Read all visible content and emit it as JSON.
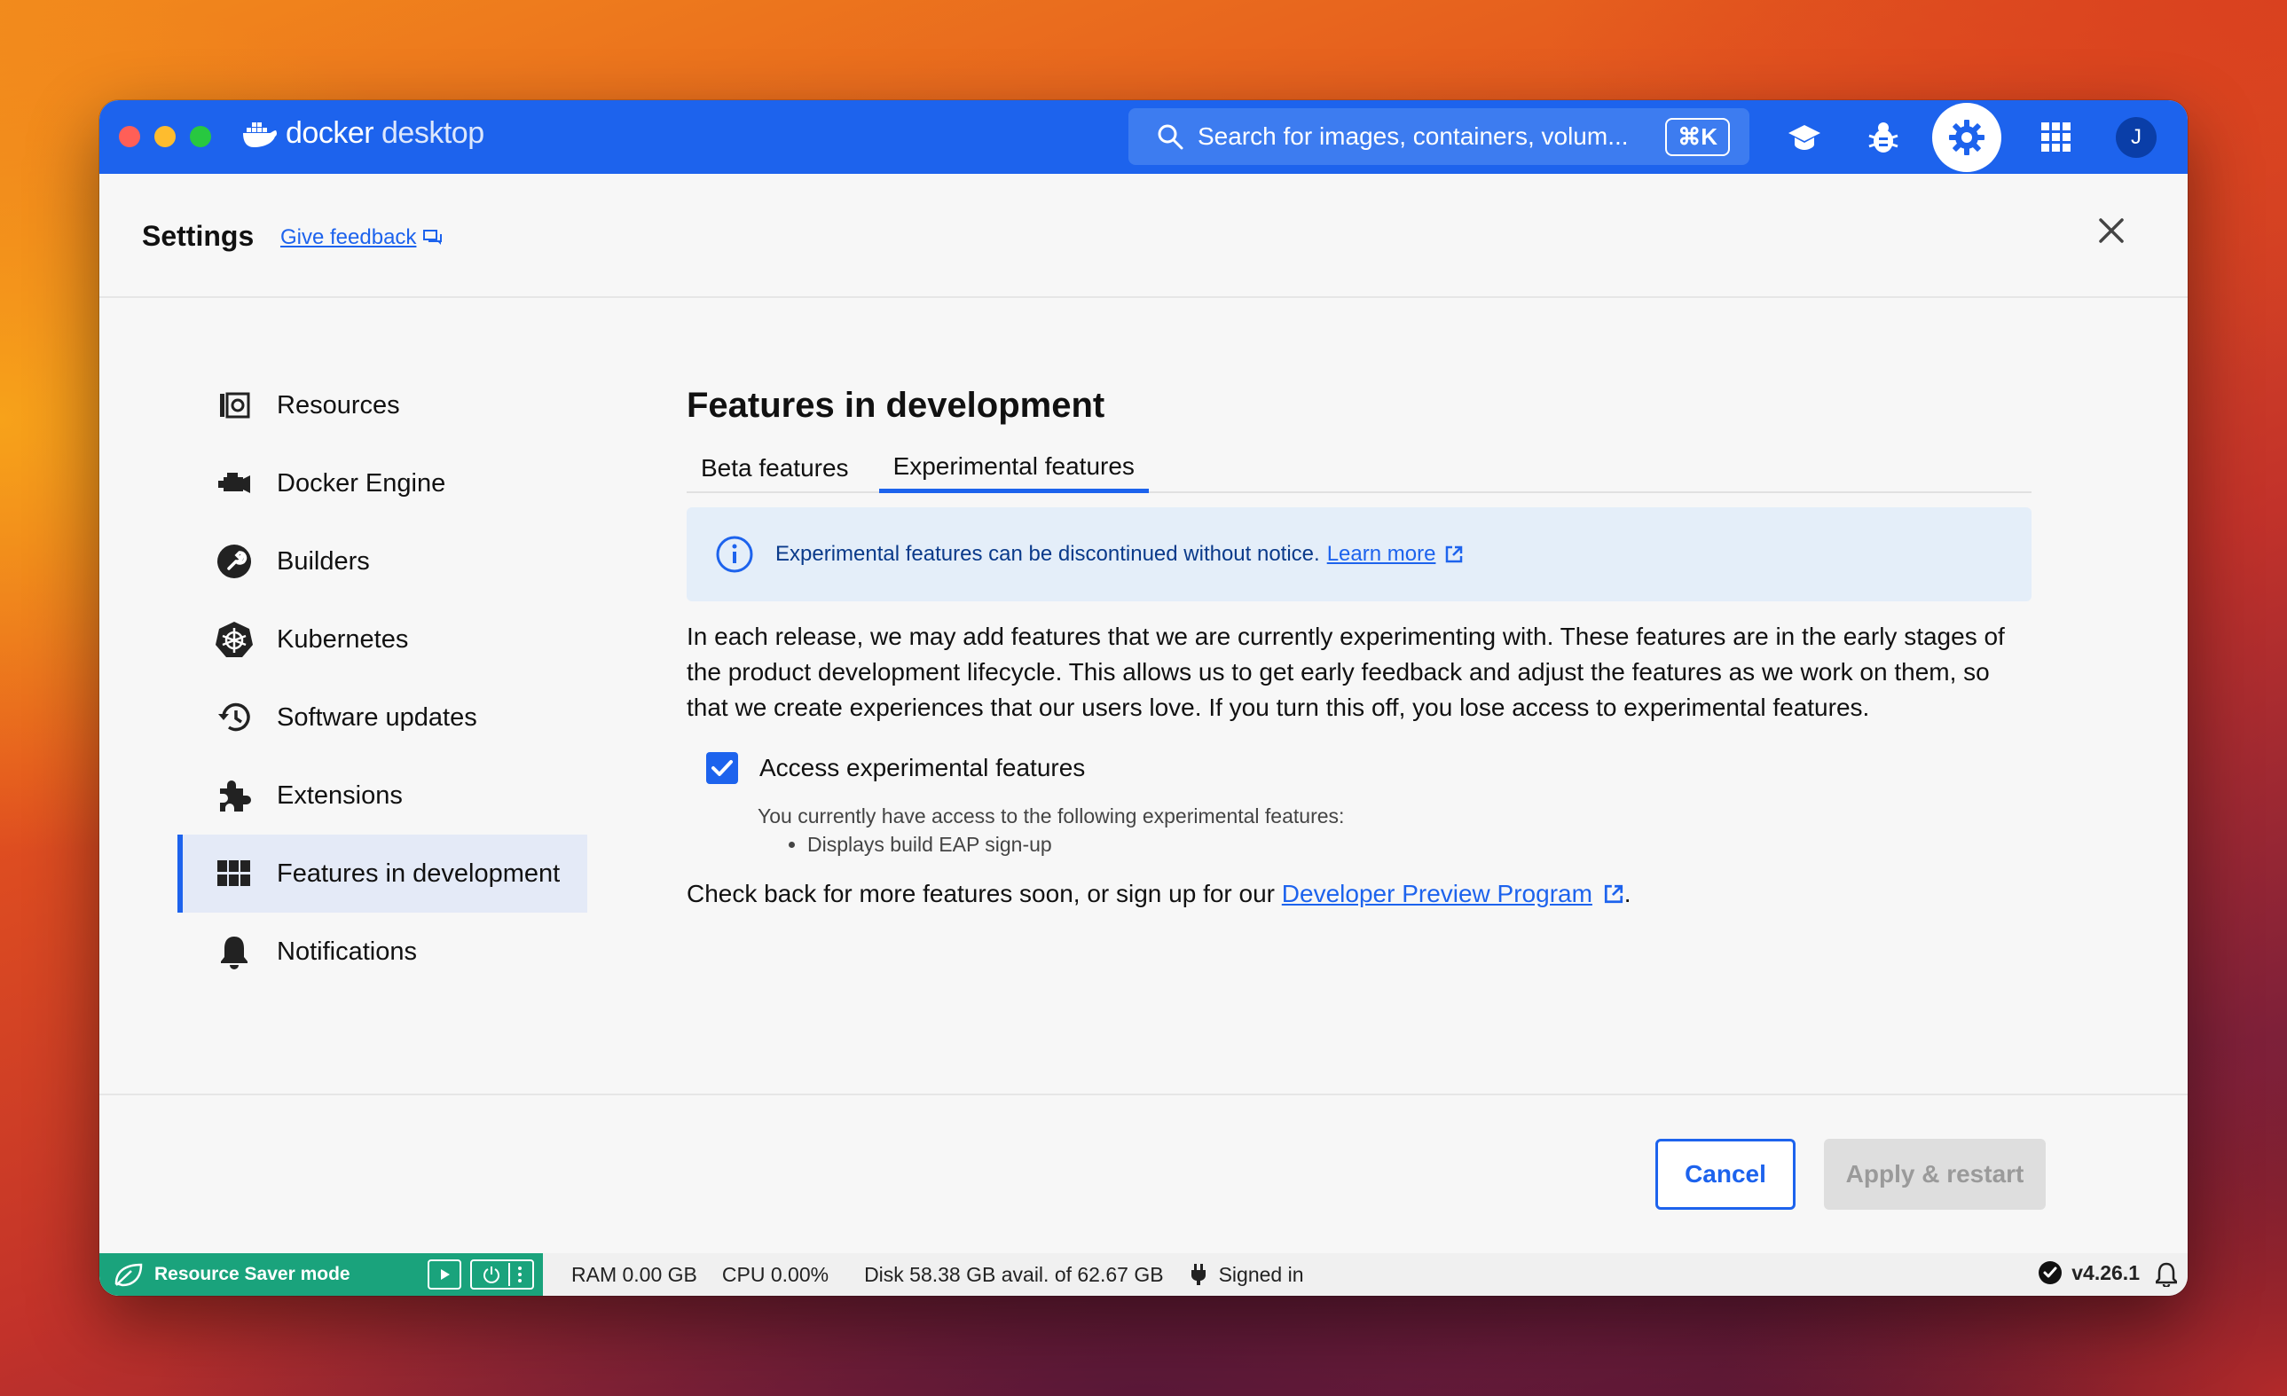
{
  "app": {
    "brand_main": "docker",
    "brand_sub": "desktop",
    "search_placeholder": "Search for images, containers, volum...",
    "search_shortcut": "⌘K",
    "avatar_initial": "J"
  },
  "header": {
    "title": "Settings",
    "feedback": "Give feedback"
  },
  "sidebar": {
    "items": [
      {
        "label": "Resources",
        "icon": "resources-icon"
      },
      {
        "label": "Docker Engine",
        "icon": "engine-icon"
      },
      {
        "label": "Builders",
        "icon": "wrench-icon"
      },
      {
        "label": "Kubernetes",
        "icon": "helm-icon"
      },
      {
        "label": "Software updates",
        "icon": "history-icon"
      },
      {
        "label": "Extensions",
        "icon": "puzzle-icon"
      },
      {
        "label": "Features in development",
        "icon": "grid-icon",
        "active": true
      },
      {
        "label": "Notifications",
        "icon": "bell-icon"
      }
    ]
  },
  "main": {
    "title": "Features in development",
    "tabs": [
      {
        "label": "Beta features"
      },
      {
        "label": "Experimental features",
        "active": true
      }
    ],
    "info": "Experimental features can be discontinued without notice.",
    "info_link": "Learn more",
    "description": "In each release, we may add features that we are currently experimenting with. These features are in the early stages of the product development lifecycle. This allows us to get early feedback and adjust the features as we work on them, so that we create experiences that our users love. If you turn this off, you lose access to experimental features.",
    "checkbox_label": "Access experimental features",
    "checkbox_checked": true,
    "access_text": "You currently have access to the following experimental features:",
    "access_items": [
      "Displays build EAP sign-up"
    ],
    "check_back": "Check back for more features soon, or sign up for our",
    "check_back_link": "Developer Preview Program",
    "check_back_end": "."
  },
  "footer": {
    "cancel": "Cancel",
    "apply": "Apply & restart"
  },
  "status": {
    "resource_saver": "Resource Saver mode",
    "ram": "RAM 0.00 GB",
    "cpu": "CPU 0.00%",
    "disk": "Disk 58.38 GB avail. of 62.67 GB",
    "signed_in": "Signed in",
    "version": "v4.26.1"
  },
  "colors": {
    "accent": "#1d63ed",
    "resource_saver": "#1aa37c"
  }
}
